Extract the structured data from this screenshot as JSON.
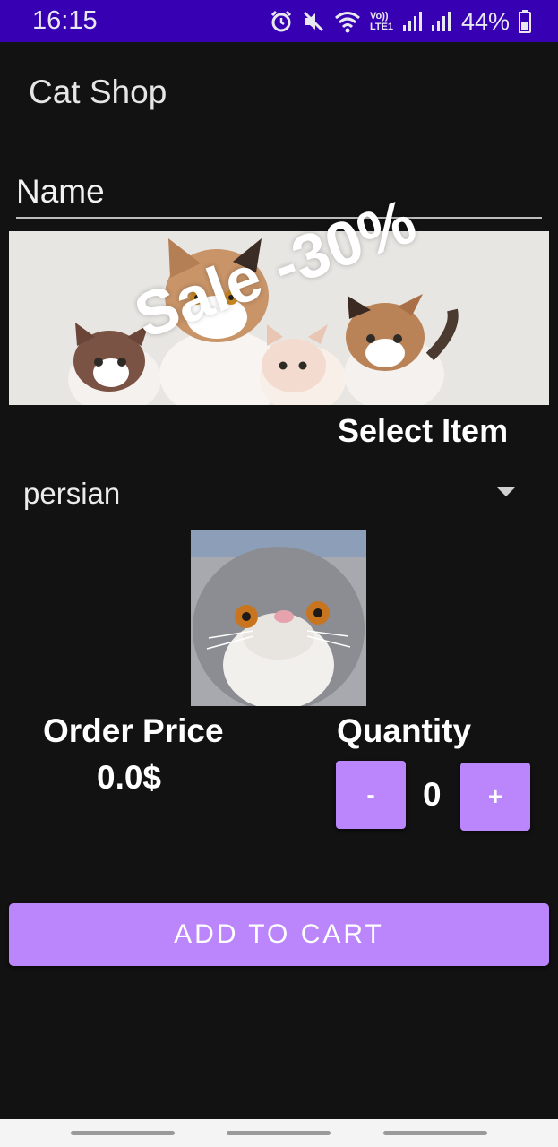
{
  "status_bar": {
    "time": "16:15",
    "network_label": "Vo)) LTE1",
    "battery_percent": "44%",
    "icons": [
      "alarm-icon",
      "mute-icon",
      "wifi-icon",
      "volte-icon",
      "signal-icon",
      "signal-icon",
      "battery-icon"
    ]
  },
  "app": {
    "title": "Cat Shop"
  },
  "form": {
    "name_placeholder": "Name"
  },
  "banner": {
    "sale_text": "Sale -30%"
  },
  "item_select": {
    "label": "Select Item",
    "selected": "persian"
  },
  "order": {
    "price_label": "Order Price",
    "price_value": "0.0$"
  },
  "quantity": {
    "label": "Quantity",
    "minus_label": "-",
    "plus_label": "+",
    "value": "0"
  },
  "actions": {
    "add_to_cart": "ADD TO CART"
  },
  "colors": {
    "status_bar": "#3700B3",
    "background": "#121212",
    "accent": "#BB86FC"
  }
}
